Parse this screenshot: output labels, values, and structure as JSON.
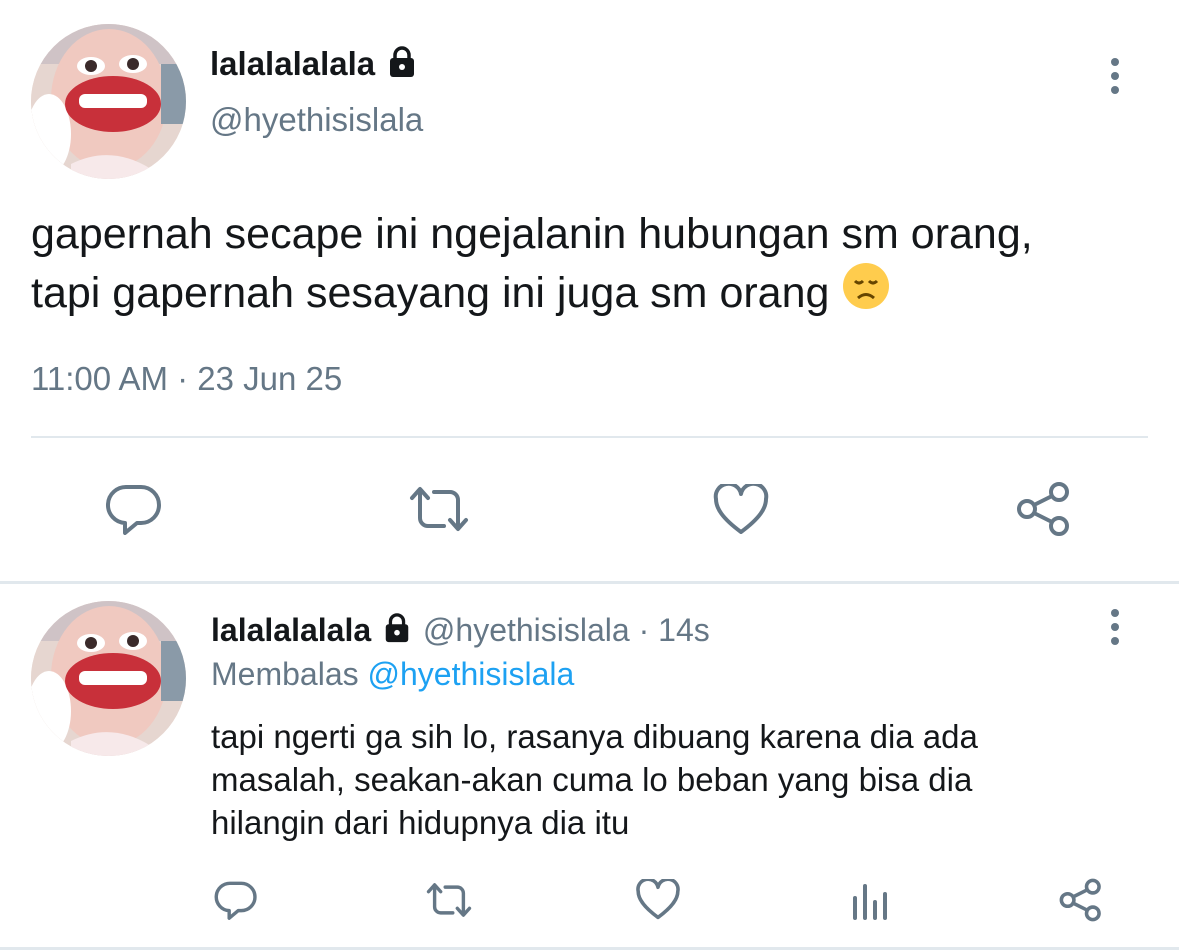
{
  "main_tweet": {
    "display_name": "lalalalalala",
    "handle": "@hyethisislala",
    "text_line1": "gapernah secape ini ngejalanin hubungan sm orang,",
    "text_line2": "tapi gapernah sesayang ini juga sm orang",
    "emoji": "😞",
    "timestamp": "11:00 AM · 23 Jun 25"
  },
  "reply_tweet": {
    "display_name": "lalalalalala",
    "handle": "@hyethisislala",
    "separator": "·",
    "age": "14s",
    "replying_prefix": "Membalas",
    "replying_to": "@hyethisislala",
    "text_line1": "tapi ngerti ga sih lo, rasanya dibuang karena dia ada",
    "text_line2": "masalah, seakan-akan cuma lo beban yang bisa dia",
    "text_line3": "hilangin dari hidupnya dia itu"
  },
  "icons": {
    "lock": "lock-icon",
    "more": "more-vertical-icon",
    "reply": "reply-icon",
    "retweet": "retweet-icon",
    "like": "heart-icon",
    "share": "share-icon",
    "analytics": "analytics-icon"
  },
  "colors": {
    "text": "#14171a",
    "secondary": "#657786",
    "link": "#1da1f2",
    "divider": "#e1e8ed"
  }
}
